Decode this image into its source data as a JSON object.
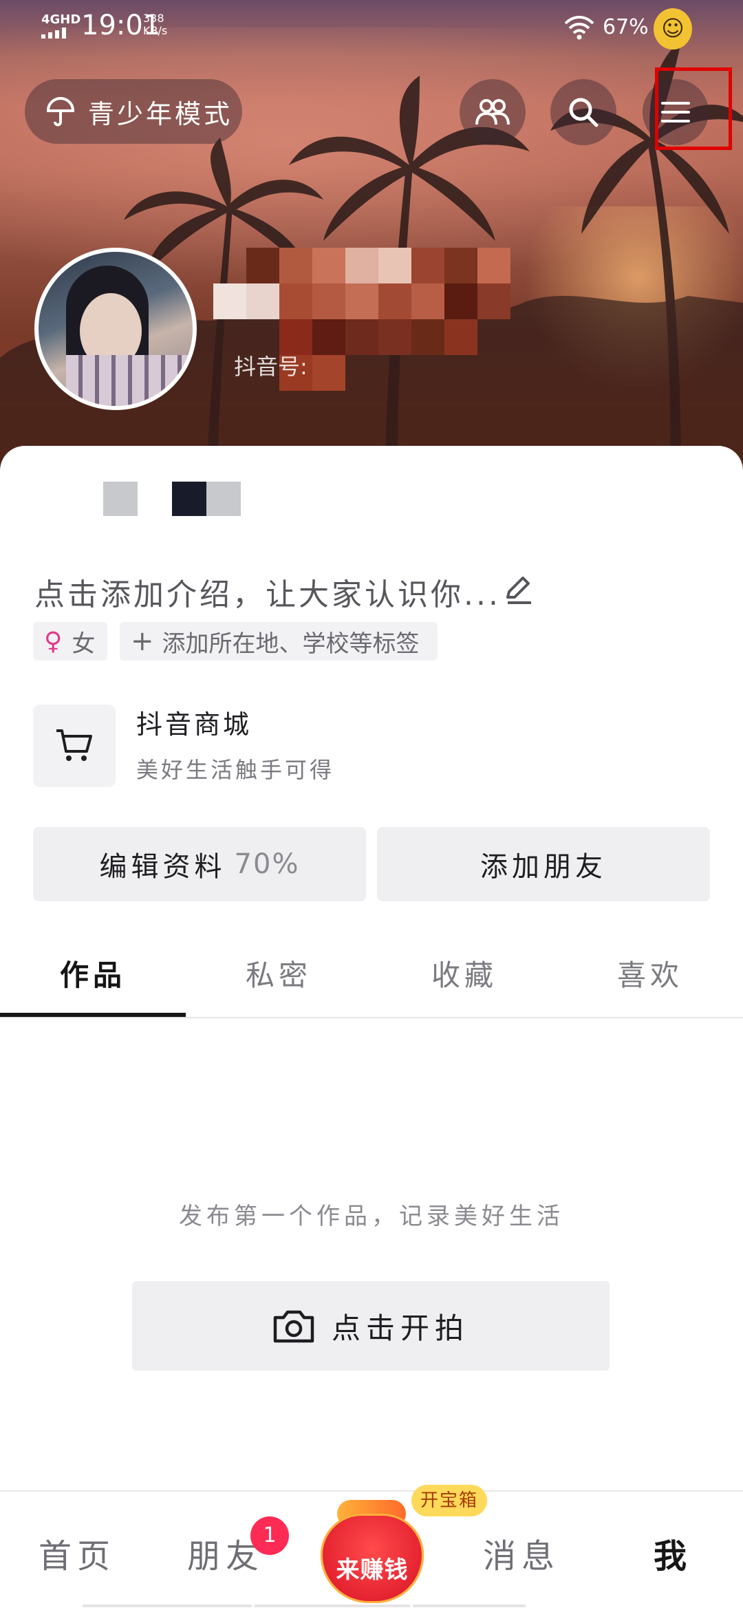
{
  "status_bar": {
    "network": "4GHD",
    "time": "19:01",
    "speed_value": "338",
    "speed_unit": "KB/s",
    "battery": "67%",
    "emoji": "☺"
  },
  "top_bar": {
    "teen_mode_label": "青少年模式",
    "friends_icon": "friends-icon",
    "search_icon": "search-icon",
    "menu_icon": "menu-icon"
  },
  "profile": {
    "douyin_id_label": "抖音号:",
    "intro_placeholder": "点击添加介绍，让大家认识你...",
    "gender_symbol": "♀",
    "gender_label": "女",
    "add_tags_label": "添加所在地、学校等标签"
  },
  "mall": {
    "title": "抖音商城",
    "subtitle": "美好生活触手可得"
  },
  "actions": {
    "edit_profile_label": "编辑资料",
    "edit_profile_progress": "70%",
    "add_friends_label": "添加朋友"
  },
  "tabs": [
    {
      "label": "作品",
      "active": true
    },
    {
      "label": "私密",
      "active": false
    },
    {
      "label": "收藏",
      "active": false
    },
    {
      "label": "喜欢",
      "active": false
    }
  ],
  "empty_state": {
    "message": "发布第一个作品，记录美好生活",
    "shoot_label": "点击开拍"
  },
  "bottom_nav": {
    "home": "首页",
    "friends": "朋友",
    "friends_badge": "1",
    "earn": "来赚钱",
    "treasure": "开宝箱",
    "messages": "消息",
    "me": "我"
  },
  "colors": {
    "accent_red": "#fe2c55",
    "highlight_box": "#e00000",
    "gender_pink": "#e4378a"
  }
}
